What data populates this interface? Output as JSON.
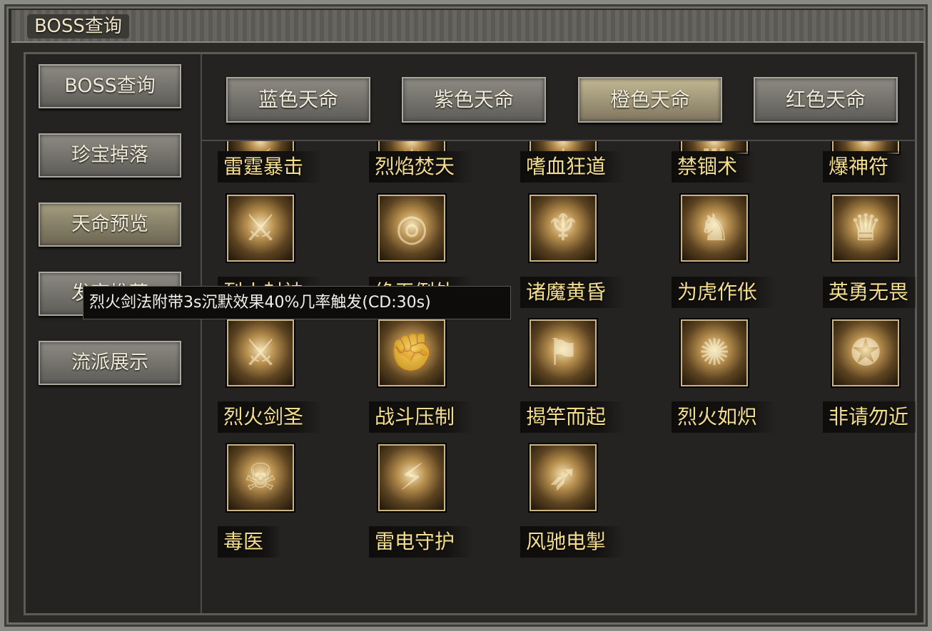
{
  "window": {
    "title": "BOSS查询"
  },
  "sidebar": {
    "items": [
      {
        "label": "BOSS查询",
        "active": false
      },
      {
        "label": "珍宝掉落",
        "active": false
      },
      {
        "label": "天命预览",
        "active": true
      },
      {
        "label": "发育推荐",
        "active": false
      },
      {
        "label": "流派展示",
        "active": false
      }
    ]
  },
  "tabs": [
    {
      "label": "蓝色天命",
      "active": false
    },
    {
      "label": "紫色天命",
      "active": false
    },
    {
      "label": "橙色天命",
      "active": true
    },
    {
      "label": "红色天命",
      "active": false
    }
  ],
  "skills": [
    {
      "name": "雷霆暴击",
      "icon": "lightning-strike-icon"
    },
    {
      "name": "烈焰焚天",
      "icon": "flame-sky-icon"
    },
    {
      "name": "嗜血狂道",
      "icon": "bloodthirst-icon"
    },
    {
      "name": "禁锢术",
      "icon": "imprison-icon"
    },
    {
      "name": "爆神符",
      "icon": "explosive-talisman-icon"
    },
    {
      "name": "烈火封神",
      "icon": "fire-seal-icon"
    },
    {
      "name": "绝无例外",
      "icon": "no-exception-icon"
    },
    {
      "name": "诸魔黄昏",
      "icon": "demon-twilight-icon"
    },
    {
      "name": "为虎作伥",
      "icon": "tiger-accomplice-icon"
    },
    {
      "name": "英勇无畏",
      "icon": "fearless-icon"
    },
    {
      "name": "烈火剑圣",
      "icon": "fire-sword-saint-icon"
    },
    {
      "name": "战斗压制",
      "icon": "combat-suppression-icon"
    },
    {
      "name": "揭竿而起",
      "icon": "uprising-icon"
    },
    {
      "name": "烈火如炽",
      "icon": "blazing-fire-icon"
    },
    {
      "name": "非请勿近",
      "icon": "keep-away-icon"
    },
    {
      "name": "毒医",
      "icon": "poison-doctor-icon"
    },
    {
      "name": "雷电守护",
      "icon": "thunder-guard-icon"
    },
    {
      "name": "风驰电掣",
      "icon": "wind-lightning-icon"
    }
  ],
  "tooltip": {
    "text": "烈火剑法附带3s沉默效果40%几率触发(CD:30s)"
  },
  "colors": {
    "skill_label": "#f4dd8c",
    "active_tab": "#c3b893"
  }
}
